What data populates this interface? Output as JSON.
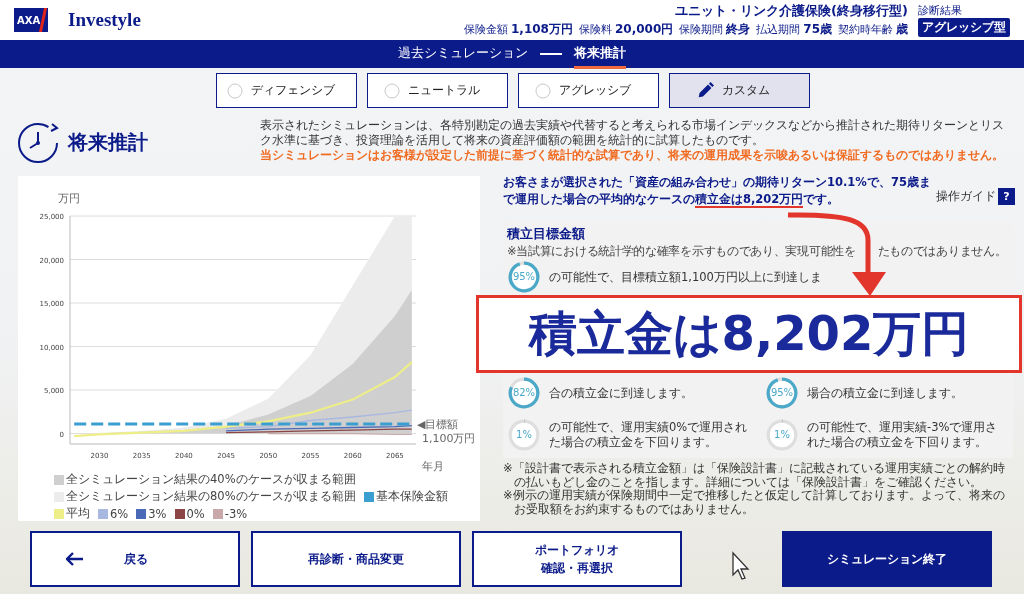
{
  "header": {
    "logo": "AXA",
    "brand": "Investyle",
    "product": "ユニット・リンク介護保険(終身移行型)",
    "details": [
      {
        "label": "保険金額",
        "value": "1,108万円"
      },
      {
        "label": "保険料",
        "value": "20,000円"
      },
      {
        "label": "保険期間",
        "value": "終身"
      },
      {
        "label": "払込期間",
        "value": "75歳"
      },
      {
        "label": "契約時年齢",
        "value": "歳"
      }
    ],
    "diagnosis_label": "診断結果",
    "diagnosis": "アグレッシブ型"
  },
  "nav": [
    {
      "label": "過去シミュレーション",
      "selected": false
    },
    {
      "label": "将来推計",
      "selected": true
    }
  ],
  "tabs": [
    {
      "label": "ディフェンシブ",
      "kind": "radio",
      "selected": false
    },
    {
      "label": "ニュートラル",
      "kind": "radio",
      "selected": false
    },
    {
      "label": "アグレッシブ",
      "kind": "radio",
      "selected": false
    },
    {
      "label": "カスタム",
      "kind": "custom",
      "selected": true
    }
  ],
  "section_title": "将来推計",
  "description": "表示されたシミュレーションは、各特別勘定の過去実績や代替すると考えられる市場インデックスなどから推計された期待リターンとリスク水準に基づき、投資理論を活用して将来の資産評価額の範囲を統計的に試算したものです。",
  "warning": "当シミュレーションはお客様が設定した前提に基づく統計的な試算であり、将来の運用成果を示唆あるいは保証するものではありません。",
  "chart": {
    "chart_data": {
      "type": "area",
      "grid": true,
      "ylabel": "万円",
      "xlabel": "年月",
      "x": [
        2027,
        2030,
        2035,
        2040,
        2045,
        2050,
        2055,
        2060,
        2065,
        2067
      ],
      "xlim": [
        2026.5,
        2067.5
      ],
      "ylim": [
        -1200,
        25000
      ],
      "xticks": [
        2030,
        2035,
        2040,
        2045,
        2050,
        2055,
        2060,
        2065
      ],
      "yticks": [
        {
          "value": 0,
          "label": "0"
        },
        {
          "value": 5000,
          "label": "5,000"
        },
        {
          "value": 10000,
          "label": "10,000"
        },
        {
          "value": 15000,
          "label": "15,000"
        },
        {
          "value": 20000,
          "label": "20,000"
        },
        {
          "value": 25000,
          "label": "25,000"
        }
      ],
      "series": [
        {
          "name": "全シミュレーション結果の40%のケースが収まる範囲",
          "type": "area",
          "color": "#cfcfcf",
          "values": [
            0,
            0,
            200,
            400,
            900,
            2200,
            4300,
            8000,
            13500,
            16500
          ]
        },
        {
          "name": "全シミュレーション結果の80%のケースが収まる範囲",
          "type": "area",
          "color": "#ececec",
          "values": [
            0,
            100,
            300,
            700,
            1700,
            4000,
            9000,
            17000,
            25000,
            25000
          ]
        },
        {
          "name": "基本保険金額",
          "type": "line",
          "line_style": "dashed",
          "color": "#3a9fd0",
          "values": [
            1100,
            1100,
            1100,
            1100,
            1100,
            1100,
            1100,
            1100,
            1100,
            1100
          ]
        },
        {
          "name": "平均",
          "type": "line",
          "color": "#eeee88",
          "values": [
            -300,
            -100,
            100,
            300,
            800,
            1400,
            2400,
            3900,
            6500,
            8200
          ]
        },
        {
          "name": "6%",
          "type": "line",
          "color": "#a8b8e0",
          "values": [
            null,
            null,
            null,
            null,
            600,
            800,
            1500,
            1900,
            2400,
            2700
          ]
        },
        {
          "name": "3%",
          "type": "line",
          "color": "#4a6ab8",
          "values": [
            null,
            null,
            null,
            null,
            300,
            500,
            600,
            700,
            800,
            900
          ]
        },
        {
          "name": "0%",
          "type": "line",
          "color": "#8b4545",
          "values": [
            null,
            null,
            null,
            null,
            100,
            200,
            300,
            400,
            500,
            500
          ]
        },
        {
          "name": "-3%",
          "type": "line",
          "color": "#c8a8a8",
          "values": [
            null,
            null,
            null,
            null,
            null,
            0,
            0,
            0,
            -100,
            -100
          ]
        }
      ],
      "annotations": [
        {
          "text": "◀目標額",
          "x": 2067.5,
          "y": 1100
        },
        "1,100万円"
      ]
    }
  },
  "summary": {
    "before": "お客さまが選択された「資産の組み合わせ」の期待リターン10.1%で、75歳まで運用した場合の平均的なケースの",
    "highlight": "積立金は8,202万円",
    "after": "です。"
  },
  "guide": {
    "label": "操作ガイド",
    "icon": "?"
  },
  "target": {
    "title": "積立目標金額",
    "note_start": "※当試算における統計学的な確率を示すものであり、実現可能性を",
    "note_end": "たものではありません。",
    "main": {
      "percent": "95%",
      "level": 0.95,
      "text": "の可能性で、目標積立額1,100万円以上に到達しま"
    },
    "items": [
      {
        "percent": "82%",
        "level": 0.82,
        "text": "合の積立金に到達します。"
      },
      {
        "percent": "95%",
        "level": 0.95,
        "text": "場合の積立金に到達します。"
      },
      {
        "percent": "1%",
        "level": 0.01,
        "text": "の可能性で、運用実績0%で運用された場合の積立金を下回ります。"
      },
      {
        "percent": "1%",
        "level": 0.01,
        "text": "の可能性で、運用実績-3%で運用された場合の積立金を下回ります。"
      }
    ]
  },
  "footnotes": [
    "※「設計書で表示される積立金額」は「保険設計書」に記載されている運用実績ごとの解約時の払いもどし金のことを指します。詳細については「保険設計書」をご確認ください。",
    "※例示の運用実績が保険期間中一定で推移したと仮定して計算しております。よって、将来のお受取額をお約束するものではありません。"
  ],
  "callout": {
    "text": "積立金は8,202万円"
  },
  "buttons": [
    {
      "label": "戻る",
      "kind": "back"
    },
    {
      "label": "再診断・商品変更",
      "kind": "plain"
    },
    {
      "label": "ポートフォリオ確認・再選択",
      "kind": "wrap"
    },
    {
      "label": "シミュレーション終了",
      "kind": "primary"
    }
  ]
}
